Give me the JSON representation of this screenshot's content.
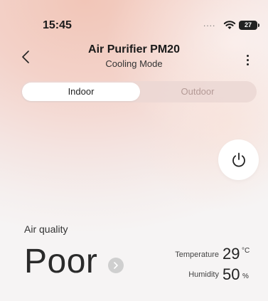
{
  "status_bar": {
    "time": "15:45",
    "signal": "....",
    "battery": "27"
  },
  "header": {
    "title": "Air Purifier PM20",
    "subtitle": "Cooling Mode"
  },
  "tabs": [
    {
      "label": "Indoor",
      "active": true
    },
    {
      "label": "Outdoor",
      "active": false
    }
  ],
  "power": {
    "icon": "power-icon"
  },
  "air_quality": {
    "label": "Air quality",
    "value": "Poor"
  },
  "metrics": {
    "temperature": {
      "label": "Temperature",
      "value": "29",
      "unit": "°C"
    },
    "humidity": {
      "label": "Humidity",
      "value": "50",
      "unit": "%"
    }
  },
  "colors": {
    "accent_gradient": "#f2c6b8",
    "background": "#f6f4f4",
    "tab_inactive_text": "#b49a96"
  }
}
